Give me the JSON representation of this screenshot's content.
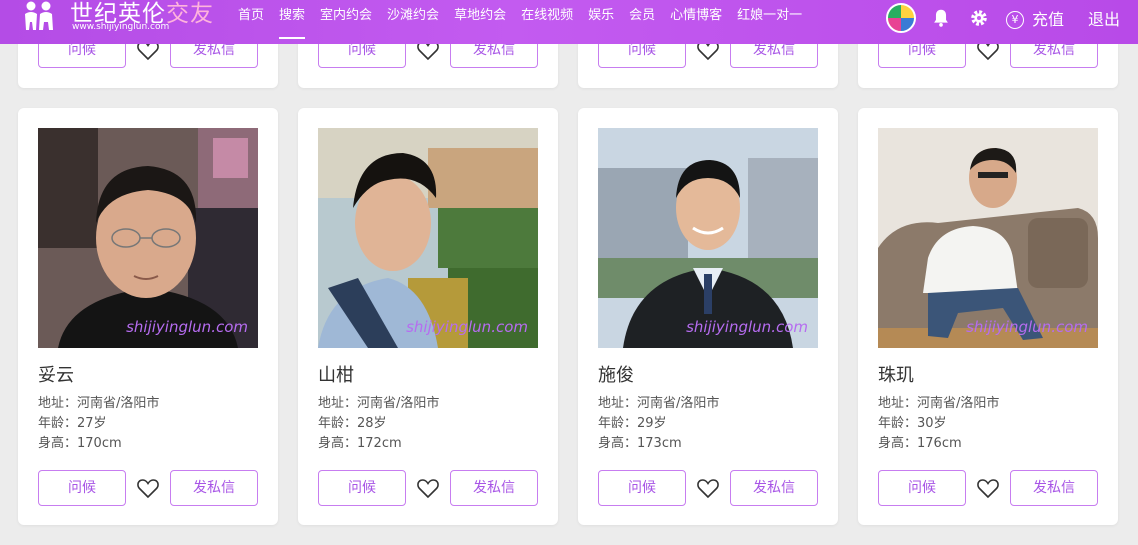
{
  "brand": {
    "title_main": "世纪英伦",
    "title_accent": "交友",
    "url": "www.shijiyinglun.com"
  },
  "nav": [
    {
      "label": "首页"
    },
    {
      "label": "搜索",
      "active": true
    },
    {
      "label": "室内约会"
    },
    {
      "label": "沙滩约会"
    },
    {
      "label": "草地约会"
    },
    {
      "label": "在线视频"
    },
    {
      "label": "娱乐"
    },
    {
      "label": "会员"
    },
    {
      "label": "心情博客"
    },
    {
      "label": "红娘一对一"
    }
  ],
  "header_right": {
    "recharge_label": "充值",
    "recharge_symbol": "¥",
    "logout_label": "退出",
    "icons": [
      "bell-icon",
      "gear-icon",
      "yen-icon"
    ]
  },
  "card_actions": {
    "greet": "问候",
    "message": "发私信",
    "favorite_icon": "heart-outline-icon"
  },
  "watermark": "shijiyinglun.com",
  "profiles": [
    {
      "name": "妥云",
      "address": "地址：河南省/洛阳市",
      "age": "年龄：27岁",
      "height": "身高：170cm"
    },
    {
      "name": "山柑",
      "address": "地址：河南省/洛阳市",
      "age": "年龄：28岁",
      "height": "身高：172cm"
    },
    {
      "name": "施俊",
      "address": "地址：河南省/洛阳市",
      "age": "年龄：29岁",
      "height": "身高：173cm"
    },
    {
      "name": "珠玑",
      "address": "地址：河南省/洛阳市",
      "age": "年龄：30岁",
      "height": "身高：176cm"
    }
  ],
  "colors": {
    "header": "#b84ae8",
    "accent": "#a856e6",
    "border": "#c77df0",
    "background": "#ececec"
  }
}
